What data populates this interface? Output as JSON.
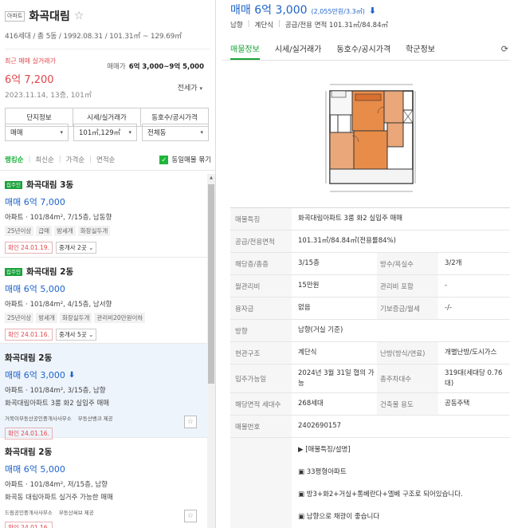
{
  "complex": {
    "type_badge": "아파트",
    "name": "화곡대림",
    "star": "☆",
    "meta": "416세대 / 총 5동 / 1992.08.31 / 101.31㎡ ~ 129.69㎡",
    "recent_label": "최근 매매 실거래가",
    "recent_price": "6억 7,200",
    "recent_date": "2023.11.14, 13층, 101㎡",
    "sale_range_label": "매매가",
    "sale_range": "6억 3,000~9억 5,000",
    "jeonse_dropdown": "전세가",
    "tabs": [
      "단지정보",
      "시세/실거래가",
      "동호수/공시가격"
    ]
  },
  "filters": {
    "trade": "매매",
    "area": "101㎡,129㎡",
    "dong": "전체동"
  },
  "sort": {
    "options": [
      "랭킹순",
      "최신순",
      "가격순",
      "면적순"
    ],
    "merge_label": "동일매물 묶기"
  },
  "listings": [
    {
      "badge": "집주인",
      "name": "화곡대림 3동",
      "price": "매매 6억 7,000",
      "spec_type": "아파트",
      "spec": " · 101/84m², 7/15층, 남동향",
      "tags": [
        "25년이상",
        "급매",
        "방세개",
        "화장실두개"
      ],
      "confirm": "확인 24.01.19.",
      "agents": "중개사 2곳"
    },
    {
      "badge": "집주인",
      "name": "화곡대림 2동",
      "price": "매매 6억 5,000",
      "spec_type": "아파트",
      "spec": " · 101/84m², 4/15층, 남서향",
      "tags": [
        "25년이상",
        "방세개",
        "화장실두개",
        "관리비20만원이하"
      ],
      "confirm": "확인 24.01.16.",
      "agents": "중개사 5곳"
    },
    {
      "name": "화곡대림 2동",
      "price": "매매 6억 3,000",
      "spec_type": "아파트",
      "spec": " · 101/84m², 3/15층, 남향",
      "desc": "화곡대림아파트 3룸 화2 실입주 매매",
      "agency": "거북이부동산공인중개사사무소",
      "provider": "부동산뱅크 제공",
      "confirm": "확인 24.01.16."
    },
    {
      "name": "화곡대림 2동",
      "price": "매매 6억 5,000",
      "spec_type": "아파트",
      "spec": " · 101/84m², 저/15층, 남향",
      "desc": "화곡동 대림아파트 실거주 가능한 매매",
      "agency": "드림공인중개사사무소",
      "provider": "부동산써브 제공",
      "confirm": "확인 24.01.16."
    }
  ],
  "detail": {
    "price": "매매 6억 3,000",
    "unit_price": "(2,055만원/3.3㎡)",
    "subinfo": [
      "남향",
      "계단식",
      "공급/전용 면적 101.31㎡/84.84㎡"
    ],
    "tabs": [
      "매물정보",
      "시세/실거래가",
      "동호수/공시가격",
      "학군정보"
    ],
    "rows": [
      {
        "label": "매물특징",
        "value": "화곡대림아파트 3룸 화2 실입주 매매"
      },
      {
        "label": "공급/전용면적",
        "value": "101.31㎡/84.84㎡(전용률84%)"
      },
      {
        "label": "해당층/총층",
        "value": "3/15층",
        "label2": "방수/욕실수",
        "value2": "3/2개"
      },
      {
        "label": "월관리비",
        "value": "15만원",
        "label2": "관리비 포함",
        "value2": "-"
      },
      {
        "label": "융자금",
        "value": "없음",
        "label2": "기보증금/월세",
        "value2": "-/-"
      },
      {
        "label": "방향",
        "value": "남향(거실 기준)"
      },
      {
        "label": "현관구조",
        "value": "계단식",
        "label2": "난방(방식/연료)",
        "value2": "개별난방/도시가스"
      },
      {
        "label": "입주가능일",
        "value": "2024년 3월 31일 협의 가능",
        "label2": "총주차대수",
        "value2": "319대(세대당 0.76대)"
      },
      {
        "label": "해당면적 세대수",
        "value": "268세대",
        "label2": "건축물 용도",
        "value2": "공동주택"
      },
      {
        "label": "매물번호",
        "value": "2402690157"
      }
    ],
    "description_label": "매물설명",
    "description": [
      "▶ [매물특징/설명]",
      "▣ 33평형아파트",
      "▣ 방3+화2+거실+통베란다+엘베 구조로 되어있습니다.",
      "▣ 남향으로 채광이 좋습니다"
    ]
  },
  "colors": {
    "accent_green": "#1aa337",
    "price_blue": "#1e63c9",
    "recent_red": "#e0474c"
  }
}
